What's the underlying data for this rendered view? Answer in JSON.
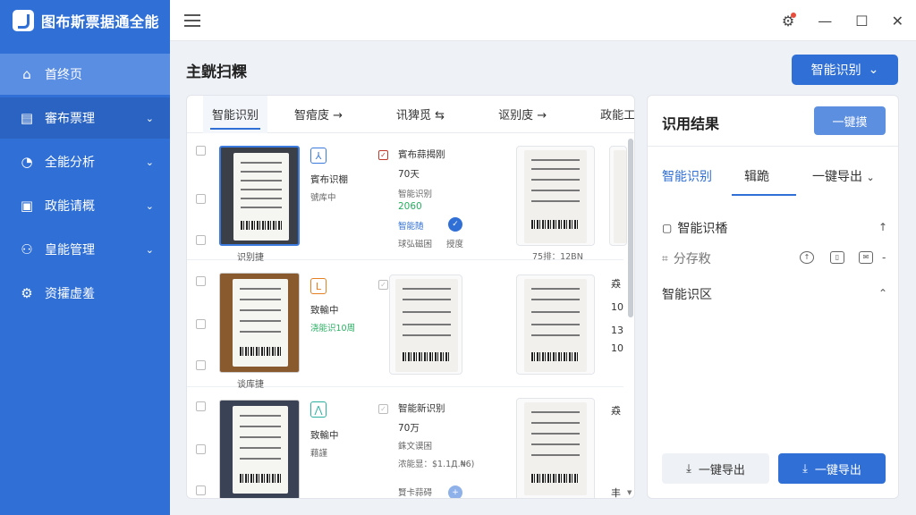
{
  "app": {
    "title": "图布斯票据通全能"
  },
  "sidebar": {
    "items": [
      {
        "label": "首终页",
        "icon": "home-icon"
      },
      {
        "label": "審布票理",
        "icon": "receipt-icon"
      },
      {
        "label": "全能分析",
        "icon": "chart-icon"
      },
      {
        "label": "政能请概",
        "icon": "document-icon"
      },
      {
        "label": "皇能管理",
        "icon": "users-icon"
      },
      {
        "label": "资攉虚羞",
        "icon": "gear-icon"
      }
    ]
  },
  "main": {
    "title": "主皝扫粿",
    "primary_button": "智能识别",
    "tabs": [
      {
        "label": "智能识别"
      },
      {
        "label": "智痯庋 →"
      },
      {
        "label": "讯猈觅 ⇆"
      },
      {
        "label": "讴别庋 →"
      },
      {
        "label": "政能工"
      }
    ],
    "rows": [
      {
        "thumb_caption": "识别捷",
        "status_title": "賓布识棚",
        "status_sub": "號库中",
        "detail_title": "賓布蒜揭刚",
        "detail_amount": "70天",
        "detail_label": "智能识别",
        "detail_value": "2060",
        "detail_link": "智能随",
        "detail_foot_left": "球弘磁困",
        "detail_foot_right": "授度",
        "card_caption": "75排：12BN"
      },
      {
        "thumb_caption": "谈库捷",
        "status_title": "致輸中",
        "status_sub": "浇能识10周",
        "edge_text_1": "猋",
        "edge_text_2": "10",
        "edge_text_3": "13",
        "edge_text_4": "10"
      },
      {
        "status_title": "致輸中",
        "status_sub": "藉謹",
        "detail_title": "智能新识别",
        "detail_amount": "70万",
        "detail_label": "銖文谟困",
        "detail_value": "浓能显：$1.1Д.₦6)",
        "detail_foot_left": "賢卡蒜碍",
        "edge_text_1": "猋",
        "edge_text_2": "丰"
      }
    ]
  },
  "result": {
    "title": "识用结果",
    "top_button": "一键摸",
    "tabs": [
      {
        "label": "智能识别"
      },
      {
        "label": "辑跪"
      },
      {
        "label": "一键导出"
      }
    ],
    "sections": [
      {
        "label": "智能识楿"
      },
      {
        "label": "分存敉"
      },
      {
        "label": "智能识区"
      }
    ],
    "footer_light": "一键导出",
    "footer_solid": "一键导出"
  }
}
